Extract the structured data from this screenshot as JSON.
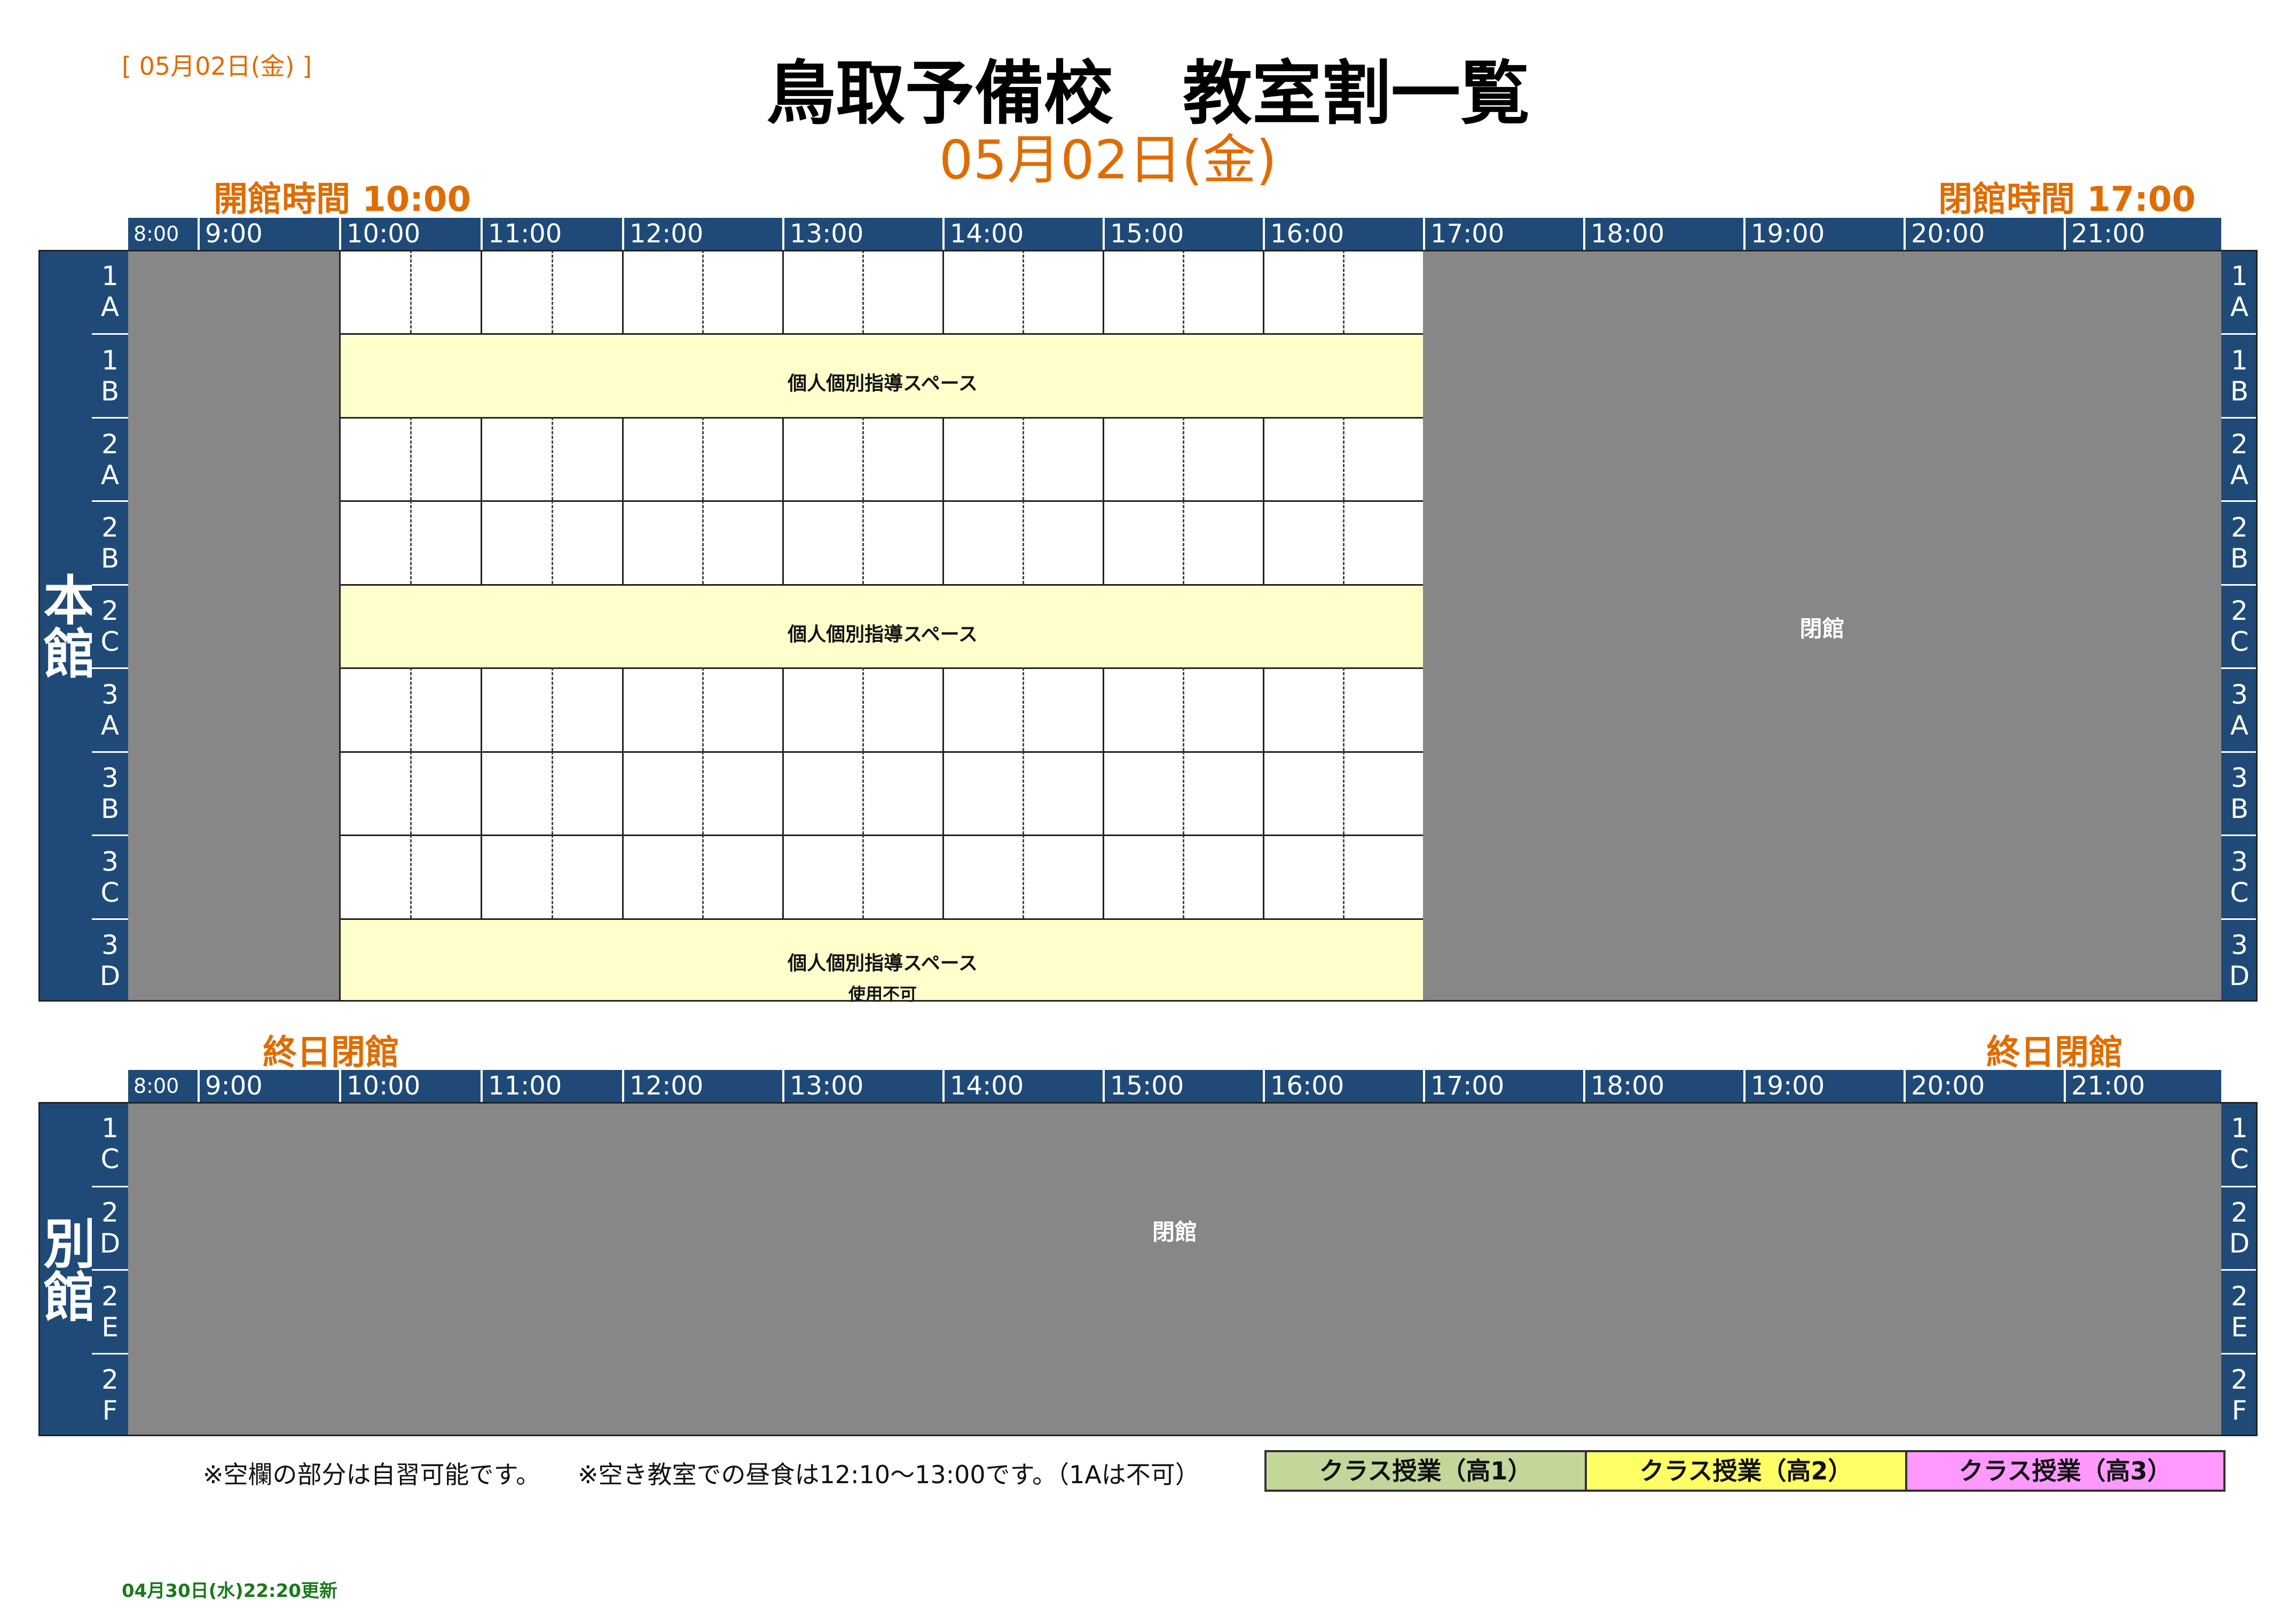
{
  "header": {
    "corner_date": "[ 05月02日(金) ]",
    "title": "鳥取予備校　教室割一覧",
    "date": "05月02日(金)"
  },
  "main_building": {
    "name": "本館",
    "open_label": "開館時間 10:00",
    "close_label": "閉館時間 17:00",
    "rooms": [
      {
        "code": "1A",
        "kind": "slots"
      },
      {
        "code": "1B",
        "kind": "space",
        "text": "個人個別指導スペース"
      },
      {
        "code": "2A",
        "kind": "slots"
      },
      {
        "code": "2B",
        "kind": "slots"
      },
      {
        "code": "2C",
        "kind": "space",
        "text": "個人個別指導スペース"
      },
      {
        "code": "3A",
        "kind": "slots"
      },
      {
        "code": "3B",
        "kind": "slots"
      },
      {
        "code": "3C",
        "kind": "slots"
      },
      {
        "code": "3D",
        "kind": "space",
        "text": "個人個別指導スペース",
        "subtext": "使用不可"
      }
    ],
    "closed_text": "閉館"
  },
  "annex": {
    "name": "別館",
    "open_label": "終日閉館",
    "close_label": "終日閉館",
    "rooms": [
      {
        "code": "1C"
      },
      {
        "code": "2D"
      },
      {
        "code": "2E"
      },
      {
        "code": "2F"
      }
    ],
    "closed_text": "閉館"
  },
  "time_headers": [
    "8:00",
    "9:00",
    "10:00",
    "11:00",
    "12:00",
    "13:00",
    "14:00",
    "15:00",
    "16:00",
    "17:00",
    "18:00",
    "19:00",
    "20:00",
    "21:00"
  ],
  "notes": {
    "note1": "※空欄の部分は自習可能です。",
    "note2": "※空き教室での昼食は12:10～13:00です。（1Aは不可）"
  },
  "legend": [
    {
      "label": "クラス授業（高1）",
      "color": "#c4d79b"
    },
    {
      "label": "クラス授業（高2）",
      "color": "#ffff66"
    },
    {
      "label": "クラス授業（高3）",
      "color": "#ff99ff"
    }
  ],
  "updated": "04月30日(水)22:20更新",
  "colors": {
    "navy": "#1f4a78",
    "closed": "#878787",
    "space": "#ffffcc",
    "accent": "#e06c00",
    "updated": "#1a7a1a"
  }
}
